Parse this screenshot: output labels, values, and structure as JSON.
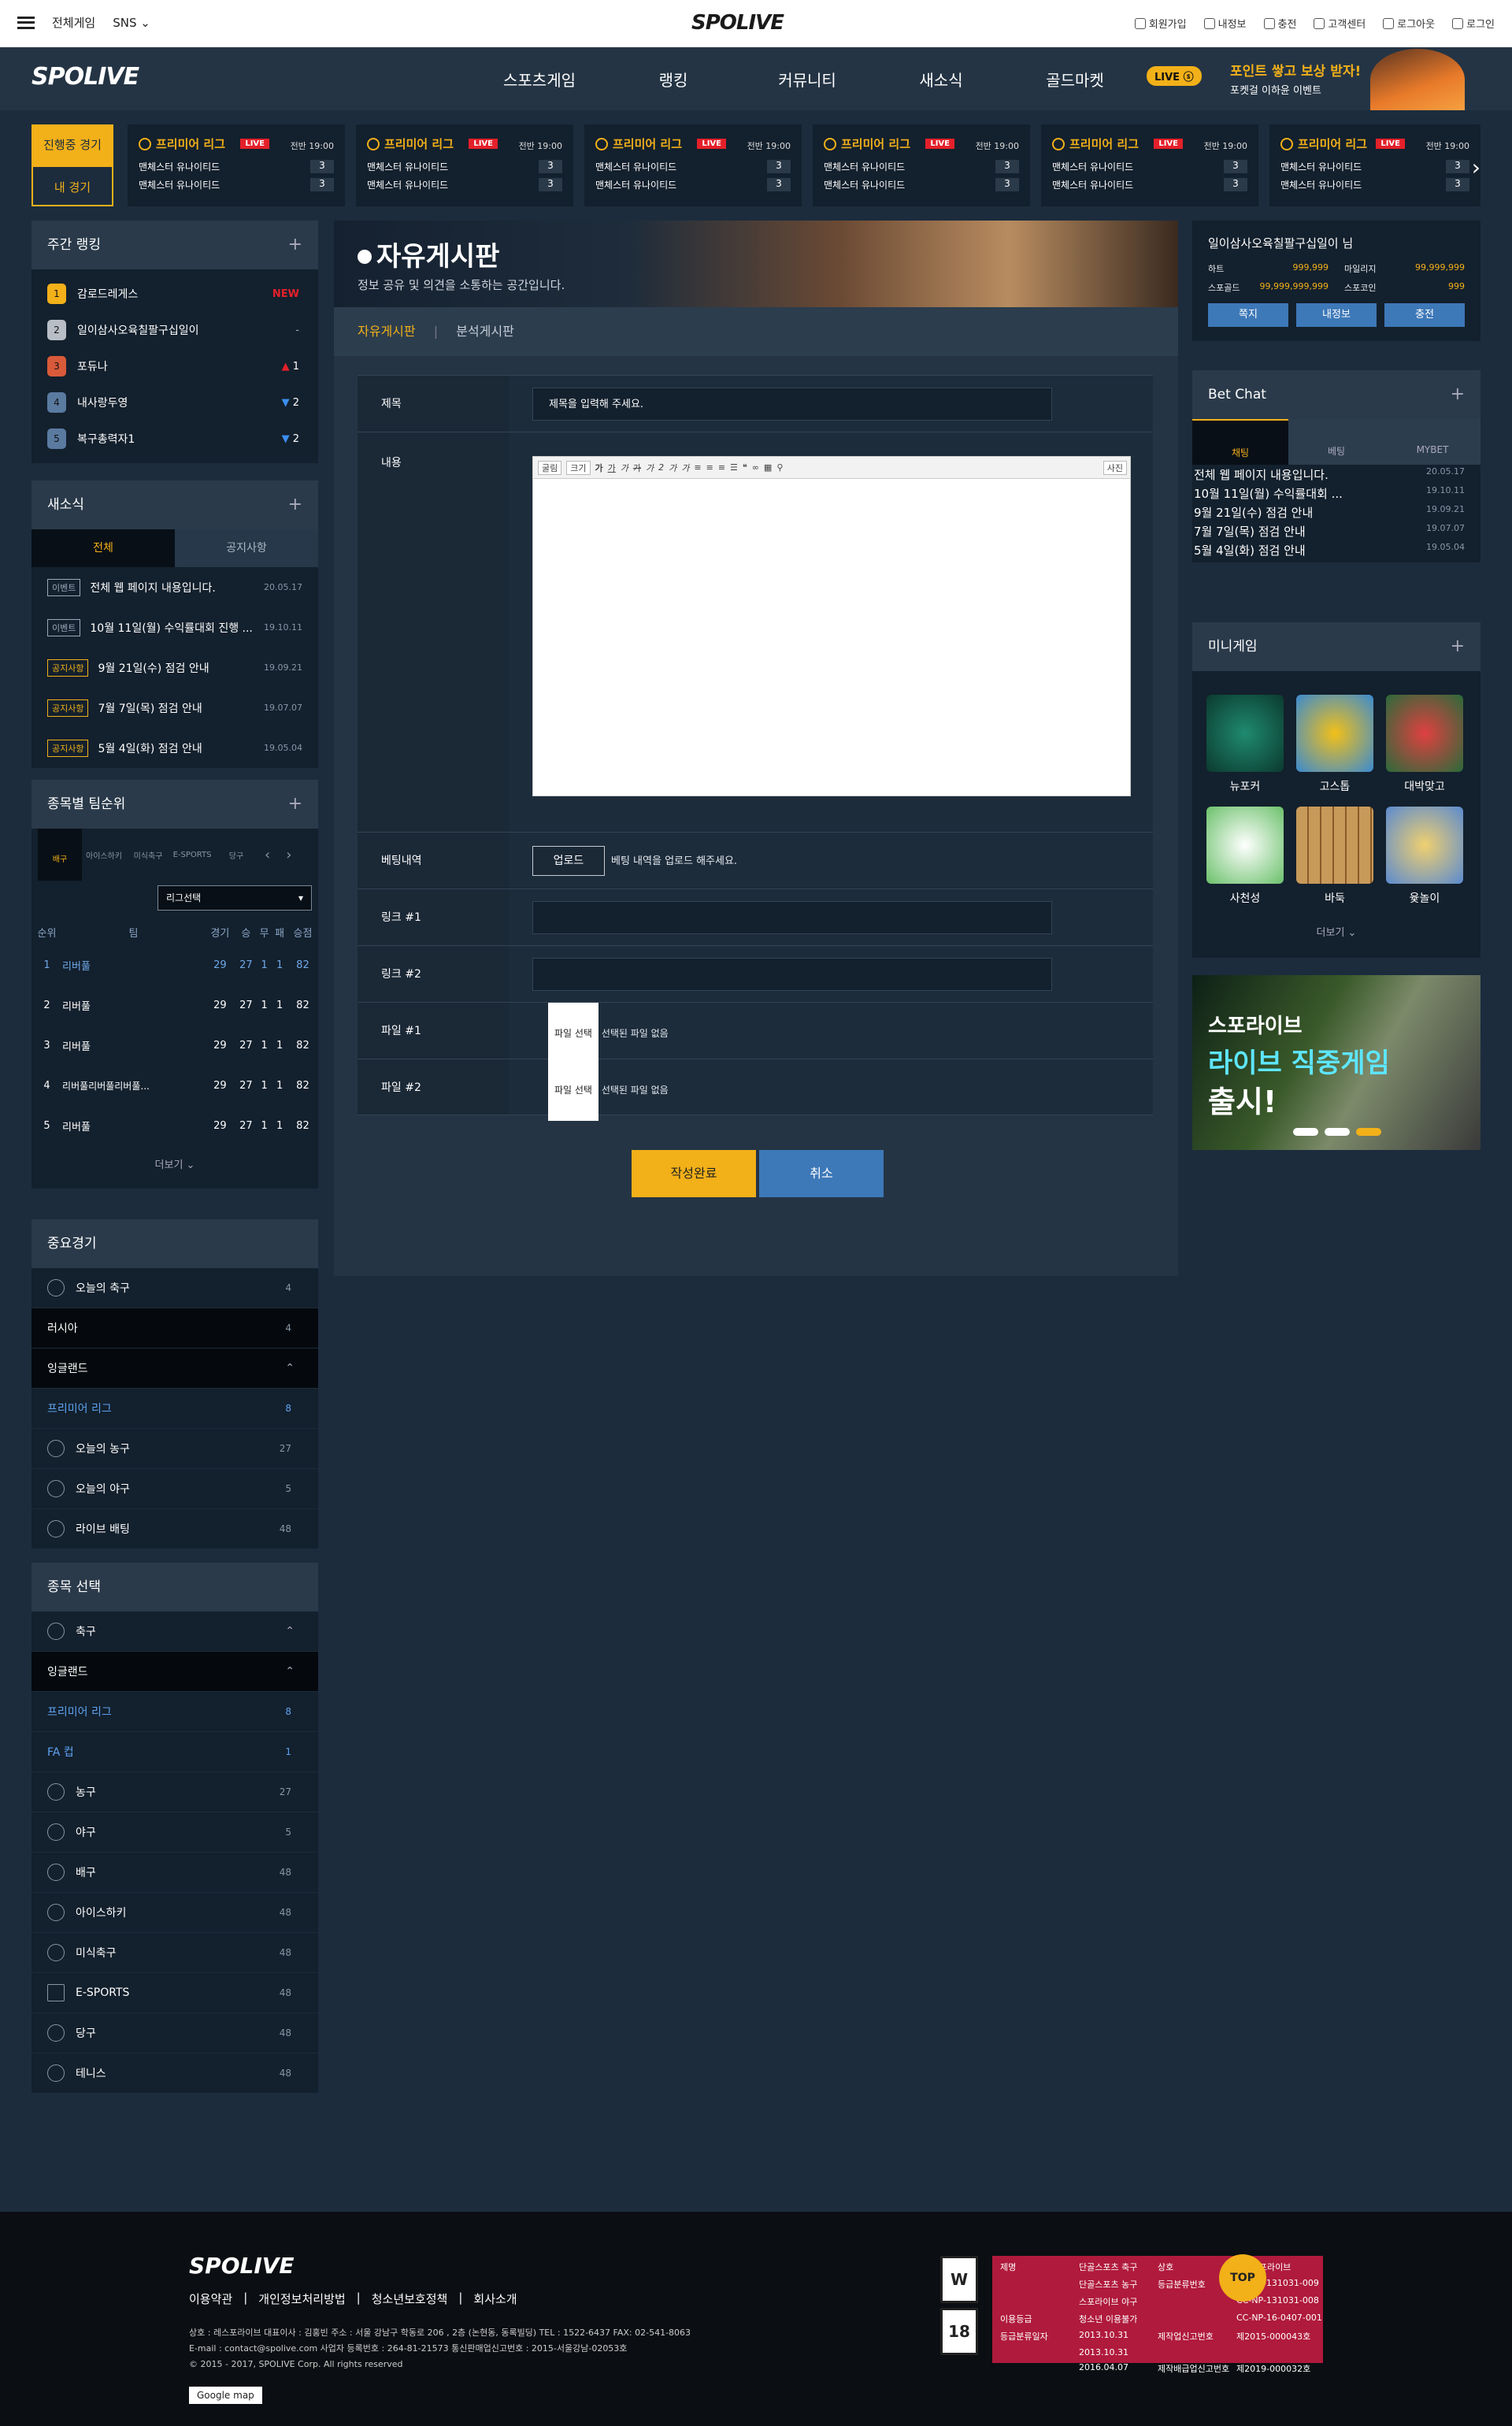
{
  "topbar": {
    "all_games": "전체게임",
    "sns": "SNS",
    "links": [
      "회원가입",
      "내정보",
      "충전",
      "고객센터",
      "로그아웃",
      "로그인"
    ]
  },
  "logo": "SPOLIVE",
  "nav": {
    "items": [
      "스포츠게임",
      "랭킹",
      "커뮤니티",
      "새소식",
      "골드마켓"
    ],
    "live_badge": "LIVE",
    "promo_title": "포인트 쌓고 보상 받자!",
    "promo_sub": "포켓걸 이하윤 이벤트"
  },
  "match_tabs": {
    "live": "진행중 경기",
    "mine": "내 경기"
  },
  "match_cards": [
    {
      "league": "프리미어 리그",
      "live": "LIVE",
      "time": "전반 19:00",
      "team1": "맨체스터 유나이티드",
      "score1": "3",
      "team2": "맨체스터 유나이티드",
      "score2": "3"
    },
    {
      "league": "프리미어 리그",
      "live": "LIVE",
      "time": "전반 19:00",
      "team1": "맨체스터 유나이티드",
      "score1": "3",
      "team2": "맨체스터 유나이티드",
      "score2": "3"
    },
    {
      "league": "프리미어 리그",
      "live": "LIVE",
      "time": "전반 19:00",
      "team1": "맨체스터 유나이티드",
      "score1": "3",
      "team2": "맨체스터 유나이티드",
      "score2": "3"
    },
    {
      "league": "프리미어 리그",
      "live": "LIVE",
      "time": "전반 19:00",
      "team1": "맨체스터 유나이티드",
      "score1": "3",
      "team2": "맨체스터 유나이티드",
      "score2": "3"
    },
    {
      "league": "프리미어 리그",
      "live": "LIVE",
      "time": "전반 19:00",
      "team1": "맨체스터 유나이티드",
      "score1": "3",
      "team2": "맨체스터 유나이티드",
      "score2": "3"
    },
    {
      "league": "프리미어 리그",
      "live": "LIVE",
      "time": "전반 19:00",
      "team1": "맨체스터 유나이티드",
      "score1": "3",
      "team2": "맨체스터 유나이티드",
      "score2": "3"
    }
  ],
  "weekly_rank": {
    "title": "주간 랭킹",
    "rows": [
      {
        "n": "1",
        "name": "감로드레게스",
        "status": "NEW"
      },
      {
        "n": "2",
        "name": "일이삼사오육칠팔구십일이",
        "status": "-"
      },
      {
        "n": "3",
        "name": "포듀나",
        "status": "1"
      },
      {
        "n": "4",
        "name": "내사랑두영",
        "status": "2"
      },
      {
        "n": "5",
        "name": "복구총력자1",
        "status": "2"
      }
    ]
  },
  "news": {
    "title": "새소식",
    "tab_all": "전체",
    "tab_notice": "공지사항",
    "rows": [
      {
        "tag": "이벤트",
        "text": "전체 웹 페이지 내용입니다.",
        "date": "20.05.17"
      },
      {
        "tag": "이벤트",
        "text": "10월 11일(월) 수익률대회 진행 ...",
        "date": "19.10.11"
      },
      {
        "tag": "공지사항",
        "text": "9월 21일(수) 점검 안내",
        "date": "19.09.21"
      },
      {
        "tag": "공지사항",
        "text": "7월 7일(목) 점검 안내",
        "date": "19.07.07"
      },
      {
        "tag": "공지사항",
        "text": "5월 4일(화) 점검 안내",
        "date": "19.05.04"
      }
    ]
  },
  "team_rank": {
    "title": "종목별 팀순위",
    "sports": [
      "배구",
      "아이스하키",
      "미식축구",
      "E-SPORTS",
      "당구"
    ],
    "select": "리그선택",
    "headers": [
      "순위",
      "팀",
      "경기",
      "승",
      "무",
      "패",
      "승점"
    ],
    "rows": [
      [
        "1",
        "리버풀",
        "29",
        "27",
        "1",
        "1",
        "82"
      ],
      [
        "2",
        "리버풀",
        "29",
        "27",
        "1",
        "1",
        "82"
      ],
      [
        "3",
        "리버풀",
        "29",
        "27",
        "1",
        "1",
        "82"
      ],
      [
        "4",
        "리버풀리버풀리버풀...",
        "29",
        "27",
        "1",
        "1",
        "82"
      ],
      [
        "5",
        "리버풀",
        "29",
        "27",
        "1",
        "1",
        "82"
      ]
    ],
    "more": "더보기"
  },
  "important": {
    "title": "중요경기",
    "rows": [
      {
        "label": "오늘의 축구",
        "count": "4"
      },
      {
        "label": "러시아",
        "count": "4"
      },
      {
        "label": "잉글랜드",
        "count": ""
      },
      {
        "label": "프리미어 리그",
        "count": "8"
      },
      {
        "label": "오늘의 농구",
        "count": "27"
      },
      {
        "label": "오늘의 야구",
        "count": "5"
      },
      {
        "label": "라이브 배팅",
        "count": "48"
      }
    ]
  },
  "sport_select": {
    "title": "종목 선택",
    "rows": [
      {
        "label": "축구",
        "count": ""
      },
      {
        "label": "잉글랜드",
        "count": ""
      },
      {
        "label": "프리미어 리그",
        "count": "8"
      },
      {
        "label": "FA 컵",
        "count": "1"
      },
      {
        "label": "농구",
        "count": "27"
      },
      {
        "label": "야구",
        "count": "5"
      },
      {
        "label": "배구",
        "count": "48"
      },
      {
        "label": "아이스하키",
        "count": "48"
      },
      {
        "label": "미식축구",
        "count": "48"
      },
      {
        "label": "E-SPORTS",
        "count": "48"
      },
      {
        "label": "당구",
        "count": "48"
      },
      {
        "label": "테니스",
        "count": "48"
      }
    ]
  },
  "board": {
    "title": "자유게시판",
    "desc": "정보 공유 및 의견을 소통하는 공간입니다.",
    "tab_free": "자유게시판",
    "tab_analysis": "분석게시판",
    "f_title": "제목",
    "title_placeholder": "제목을 입력해 주세요.",
    "f_content": "내용",
    "f_betting": "베팅내역",
    "upload": "업로드",
    "upload_hint": "베팅 내역을 업로드 해주세요.",
    "f_link1": "링크 #1",
    "f_link2": "링크 #2",
    "f_file1": "파일 #1",
    "f_file2": "파일 #2",
    "file_btn": "파일 선택",
    "file_none": "선택된 파일 없음",
    "submit": "작성완료",
    "cancel": "취소",
    "editor_tools": [
      "굴림",
      "크기",
      "가",
      "가",
      "가",
      "가",
      "가",
      "2",
      "가",
      "가",
      "사진"
    ]
  },
  "user": {
    "name": "일이삼사오육칠팔구십일이 님",
    "items": [
      {
        "k": "하트",
        "v": "999,999"
      },
      {
        "k": "마일리지",
        "v": "99,999,999"
      },
      {
        "k": "스포골드",
        "v": "99,999,999,999"
      },
      {
        "k": "스포코인",
        "v": "999"
      }
    ],
    "buttons": [
      "쪽지",
      "내정보",
      "충전"
    ]
  },
  "betchat": {
    "title": "Bet Chat",
    "tabs": [
      "채팅",
      "베팅",
      "MYBET"
    ],
    "rows": [
      {
        "text": "전체 웹 페이지 내용입니다.",
        "date": "20.05.17"
      },
      {
        "text": "10월 11일(월) 수익률대회 ...",
        "date": "19.10.11"
      },
      {
        "text": "9월 21일(수) 점검 안내",
        "date": "19.09.21"
      },
      {
        "text": "7월 7일(목) 점검 안내",
        "date": "19.07.07"
      },
      {
        "text": "5월 4일(화) 점검 안내",
        "date": "19.05.04"
      }
    ]
  },
  "minigame": {
    "title": "미니게임",
    "games": [
      "뉴포커",
      "고스톱",
      "대박맞고",
      "사천성",
      "바둑",
      "윷놀이"
    ],
    "more": "더보기"
  },
  "ad": {
    "line1": "스포라이브",
    "line2": "라이브 직중게임",
    "line3": "출시!"
  },
  "footer": {
    "links": [
      "이용약관",
      "개인정보처리방법",
      "청소년보호정책",
      "회사소개"
    ],
    "info1": "상호 : 레스포라이브 대표이사 : 김홍빈 주소 : 서울 강남구 학동로 206 , 2층 (논현동, 동록빌딩) TEL : 1522-6437 FAX: 02-541-8063",
    "info2": "E-mail : contact@spolive.com 사업자 등록번호 : 264-81-21573 통신판매업신고번호 : 2015-서울강남-02053호",
    "info3": "© 2015 - 2017, SPOLIVE Corp. All rights reserved",
    "gmap": "Google map",
    "top": "TOP",
    "rating": [
      "W",
      "18"
    ],
    "table": [
      "제명",
      "단골스포츠 축구",
      "상호",
      "(주)스포라이브",
      "",
      "단골스포츠 농구",
      "등급분류번호",
      "CC-NP-131031-009",
      "",
      "스포라이브 야구",
      "",
      "CC-NP-131031-008",
      "이용등급",
      "청소년 이용불가",
      "",
      "CC-NP-16-0407-001",
      "등급분류일자",
      "2013.10.31",
      "제작업신고번호",
      "제2015-000043호",
      "",
      "2013.10.31",
      "",
      "",
      "",
      "2016.04.07",
      "제작배급업신고번호",
      "제2019-000032호"
    ]
  }
}
